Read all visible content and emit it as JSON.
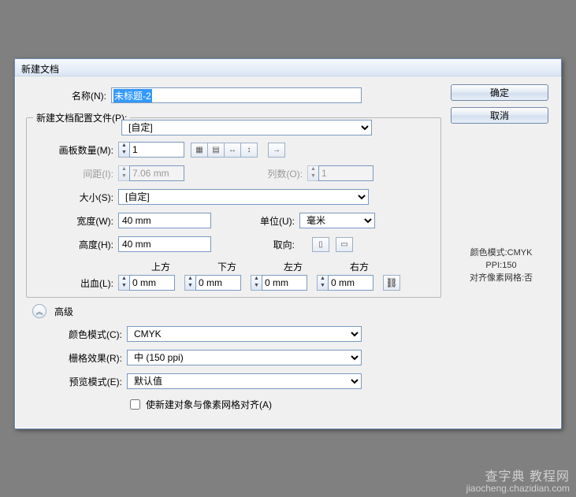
{
  "dialog": {
    "title": "新建文档",
    "name_label": "名称(N):",
    "name_value": "未标题-2",
    "profile_legend": "新建文档配置文件(P):",
    "profile_value": "[自定]",
    "artboards_label": "画板数量(M):",
    "artboards_value": "1",
    "spacing_label": "间距(I):",
    "spacing_value": "7.06 mm",
    "cols_label": "列数(O):",
    "cols_value": "1",
    "size_label": "大小(S):",
    "size_value": "[自定]",
    "width_label": "宽度(W):",
    "width_value": "40 mm",
    "units_label": "单位(U):",
    "units_value": "毫米",
    "height_label": "高度(H):",
    "height_value": "40 mm",
    "orient_label": "取向:",
    "bleed_label": "出血(L):",
    "bleed_top": "上方",
    "bleed_bottom": "下方",
    "bleed_left": "左方",
    "bleed_right": "右方",
    "bleed_val": "0 mm",
    "advanced": "高级",
    "colormode_label": "颜色模式(C):",
    "colormode_value": "CMYK",
    "raster_label": "栅格效果(R):",
    "raster_value": "中 (150 ppi)",
    "preview_label": "预览模式(E):",
    "preview_value": "默认值",
    "align_check": "使新建对象与像素网格对齐(A)"
  },
  "buttons": {
    "ok": "确定",
    "cancel": "取消"
  },
  "info": {
    "line1": "颜色模式:CMYK",
    "line2": "PPI:150",
    "line3": "对齐像素网格:否"
  },
  "watermark": {
    "l1": "查字典 教程网",
    "l2": "jiaocheng.chazidian.com"
  }
}
